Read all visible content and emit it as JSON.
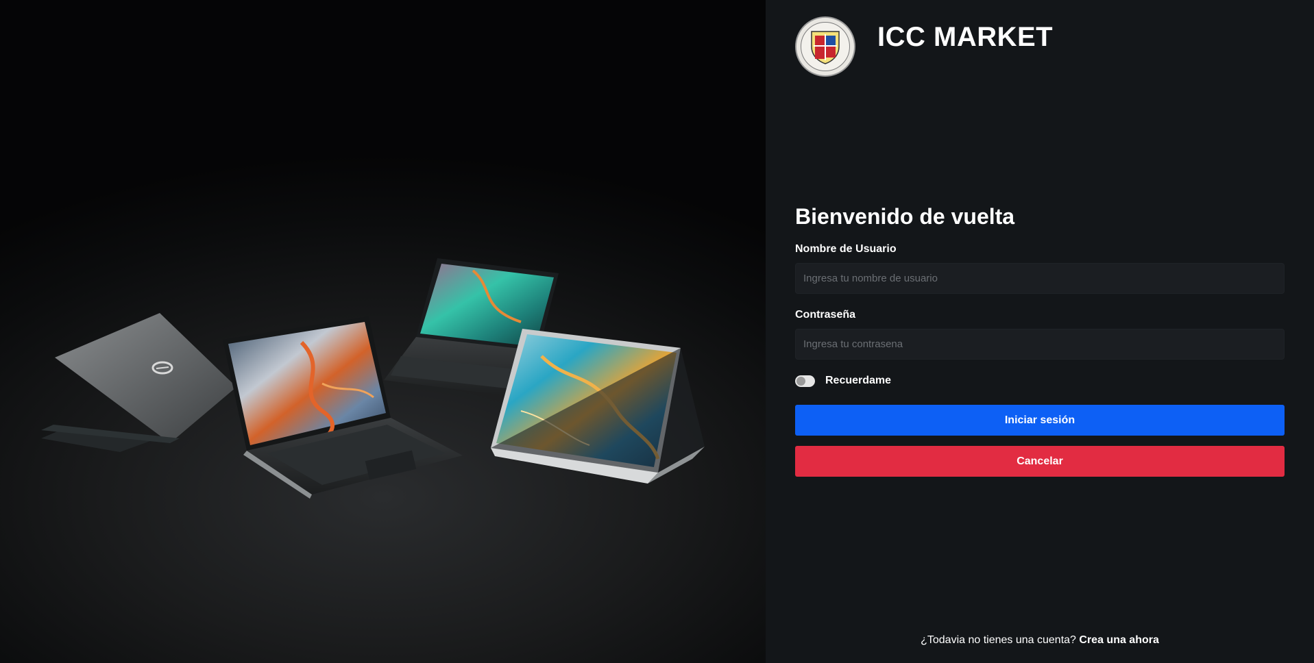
{
  "brand": {
    "title": "ICC MARKET",
    "logo_icon": "university-seal-icon"
  },
  "hero": {
    "image": "laptops-showcase"
  },
  "login": {
    "heading": "Bienvenido de vuelta",
    "username_label": "Nombre de Usuario",
    "username_placeholder": "Ingresa tu nombre de usuario",
    "username_value": "",
    "password_label": "Contraseña",
    "password_placeholder": "Ingresa tu contrasena",
    "password_value": "",
    "remember_label": "Recuerdame",
    "remember_checked": false,
    "login_button": "Iniciar sesión",
    "cancel_button": "Cancelar"
  },
  "signup": {
    "prompt": "¿Todavia no tienes una cuenta?",
    "link": "Crea una ahora"
  },
  "colors": {
    "panel_bg": "#131619",
    "primary": "#0d60f5",
    "danger": "#e22c42"
  }
}
